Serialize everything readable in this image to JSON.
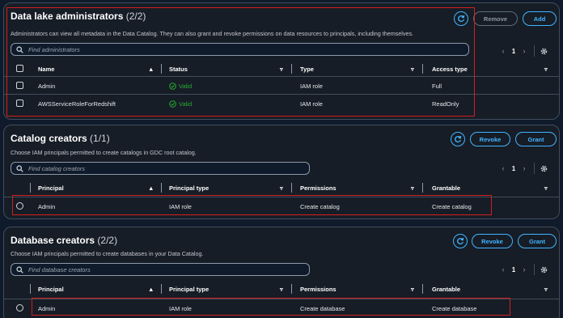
{
  "admins": {
    "title": "Data lake administrators",
    "count": "(2/2)",
    "description": "Administrators can view all metadata in the Data Catalog. They can also grant and revoke permissions on data resources to principals, including themselves.",
    "search_placeholder": "Find administrators",
    "remove_label": "Remove",
    "add_label": "Add",
    "page": "1",
    "columns": [
      "Name",
      "Status",
      "Type",
      "Access type"
    ],
    "rows": [
      {
        "name": "Admin",
        "status": "Valid",
        "type": "IAM role",
        "access": "Full"
      },
      {
        "name": "AWSServiceRoleForRedshift",
        "status": "Valid",
        "type": "IAM role",
        "access": "ReadOnly"
      }
    ]
  },
  "catalog": {
    "title": "Catalog creators",
    "count": "(1/1)",
    "description": "Choose IAM principals permitted to create catalogs in GDC root catalog.",
    "search_placeholder": "Find catalog creators",
    "revoke_label": "Revoke",
    "grant_label": "Grant",
    "page": "1",
    "columns": [
      "Principal",
      "Principal type",
      "Permissions",
      "Grantable"
    ],
    "rows": [
      {
        "principal": "Admin",
        "ptype": "IAM role",
        "permissions": "Create catalog",
        "grantable": "Create catalog"
      }
    ]
  },
  "database": {
    "title": "Database creators",
    "count": "(2/2)",
    "description": "Choose IAM principals permitted to create databases in your Data Catalog.",
    "search_placeholder": "Find database creators",
    "revoke_label": "Revoke",
    "grant_label": "Grant",
    "page": "1",
    "columns": [
      "Principal",
      "Principal type",
      "Permissions",
      "Grantable"
    ],
    "rows": [
      {
        "principal": "Admin",
        "ptype": "IAM role",
        "permissions": "Create database",
        "grantable": "Create database"
      }
    ]
  },
  "colors": {
    "accent": "#42b4ff",
    "valid": "#29ad32",
    "highlight": "#d21f1f",
    "panel": "#161d26",
    "background": "#0f1b2a"
  }
}
